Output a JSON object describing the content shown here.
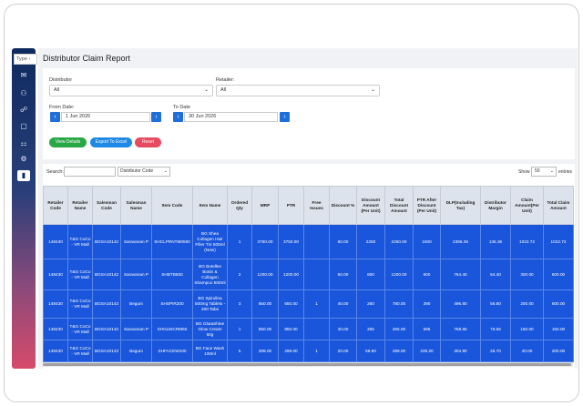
{
  "sidebar": {
    "type_box": "Type",
    "icons": [
      "mail-icon",
      "users-icon",
      "handshake-icon",
      "chat-icon",
      "org-chart-icon",
      "settings-icon",
      "bar-chart-icon"
    ]
  },
  "page": {
    "title": "Distributor Claim Report"
  },
  "filters": {
    "distributor_label": "Distributor",
    "distributor_value": "All",
    "retailer_label": "Retailer:",
    "retailer_value": "All",
    "from_label": "From Date:",
    "from_value": "1 Jun 2026",
    "to_label": "To Date",
    "to_value": "30 Jun 2026",
    "prev_symbol": "‹",
    "next_symbol": "›",
    "chevron": "⌄"
  },
  "actions": {
    "view_label": "View Details",
    "export_label": "Export To Excel",
    "reset_label": "Reset",
    "view_color": "#28a745",
    "export_color": "#1e88e5",
    "reset_color": "#e84a5f"
  },
  "table_controls": {
    "search_label": "Search:",
    "search_value": "",
    "code_select": "Distributor Code",
    "show_label": "Show",
    "show_value": "50",
    "entries_label": "entries",
    "chevron": "⌄"
  },
  "table": {
    "headers": [
      "Retailer Code",
      "Retailer Name",
      "Salesman Code",
      "Salesman Name",
      "Item Code",
      "Item Name",
      "Ordered Qty",
      "MRP",
      "PTR",
      "Free Issues",
      "Discount %",
      "Discount Amount (Per Unit)",
      "Total Discount Amount",
      "PTR After Discount (Per Unit)",
      "DLP(Including Tax)",
      "Distributor Margin",
      "Claim Amount(Per Unit)",
      "Total Claim Amount"
    ],
    "rows": [
      [
        "148430",
        "T&G CoCo - VR Mall",
        "BGSA10142",
        "Saravanan P",
        "SHCLPRNTM0500",
        "BG Shea Collagen Hair Filler Tnt 500ml (New)",
        "1",
        "3750.00",
        "3750.00",
        "",
        "60.00",
        "2250",
        "2250.00",
        "1500",
        "2386.36",
        "136.36",
        "1022.72",
        "1022.72"
      ],
      [
        "148430",
        "T&G CoCo - VR Mall",
        "BGSA10142",
        "Saravanan P",
        "SHBTB500",
        "BG Botelles Biotin & Collagen Shampoo 500ml",
        "2",
        "1200.00",
        "1200.00",
        "",
        "50.00",
        "600",
        "1200.00",
        "600",
        "764.40",
        "64.40",
        "300.00",
        "600.00"
      ],
      [
        "148430",
        "T&G CoCo - VR Mall",
        "BGSA10143",
        "Begum",
        "SHSPIR200",
        "BG Spirulina 500mg Tablets - 200 Tabs",
        "3",
        "650.00",
        "650.00",
        "1",
        "40.00",
        "260",
        "780.00",
        "390",
        "496.80",
        "56.80",
        "200.00",
        "600.00"
      ],
      [
        "148430",
        "T&G CoCo - VR Mall",
        "BGSA10142",
        "Saravanan P",
        "SHGLWCRM50",
        "BG GlutaShine Glow Cream 50g",
        "1",
        "850.00",
        "850.00",
        "",
        "30.00",
        "255",
        "255.00",
        "595",
        "758.65",
        "78.65",
        "150.00",
        "150.00"
      ],
      [
        "148430",
        "T&G CoCo - VR Mall",
        "BGSA10143",
        "Begum",
        "SHFACEW100",
        "BG Face Wash 100ml",
        "5",
        "299.00",
        "299.00",
        "1",
        "20.00",
        "59.80",
        "299.00",
        "239.20",
        "304.90",
        "25.70",
        "40.00",
        "200.00"
      ]
    ]
  }
}
